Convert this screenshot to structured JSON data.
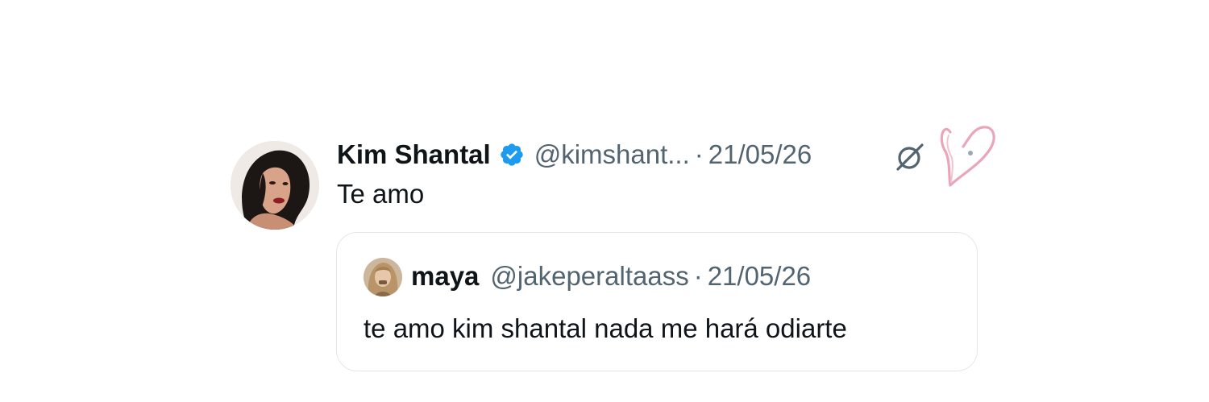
{
  "tweet": {
    "author": {
      "name": "Kim Shantal",
      "handle": "@kimshant...",
      "verified": true,
      "avatar_icon": "profile-photo"
    },
    "separator": "·",
    "date": "21/05/26",
    "text": "Te amo",
    "actions": {
      "mute_icon": "mute-circle-slash-icon",
      "heart_icon": "hand-drawn-heart-icon"
    }
  },
  "quoted_tweet": {
    "author": {
      "name": "maya",
      "handle": "@jakeperaltaass",
      "avatar_icon": "profile-photo"
    },
    "separator": "·",
    "date": "21/05/26",
    "text": "te amo kim shantal nada me hará odiarte"
  },
  "colors": {
    "text_primary": "#0f1419",
    "text_secondary": "#536471",
    "verified_blue": "#1d9bf0",
    "border": "#e1e8ed",
    "heart_pink": "#eaa6b8"
  }
}
